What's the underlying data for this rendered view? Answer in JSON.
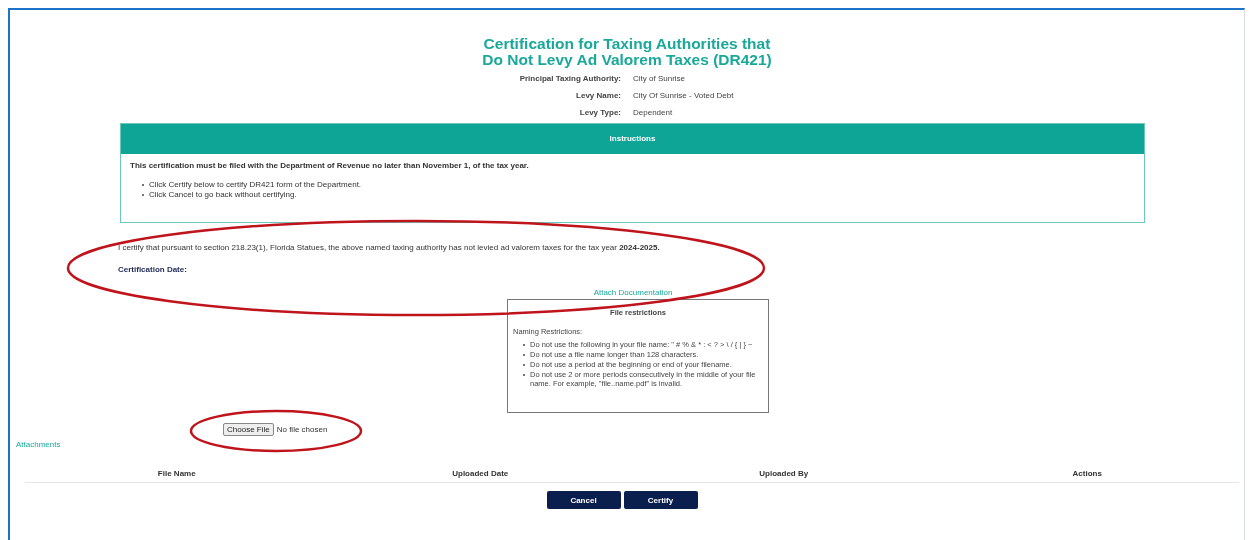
{
  "title_lines": [
    "Certification for Taxing Authorities that",
    "Do Not Levy Ad Valorem Taxes (DR421)"
  ],
  "details": [
    {
      "label": "Principal Taxing Authority:",
      "value": "City of Sunrise"
    },
    {
      "label": "Levy Name:",
      "value": "City Of Sunrise - Voted Debt"
    },
    {
      "label": "Levy Type:",
      "value": "Dependent"
    }
  ],
  "instructions": {
    "heading": "Instructions",
    "notice": "This certification must be filed with the Department of Revenue no later than November 1, of the tax year.",
    "steps": [
      "Click Certify below to certify DR421 form of the Department.",
      "Click Cancel to go back without certifying."
    ]
  },
  "certification_statement": "I certify that pursuant to section 218.23(1), Florida Statues, the above named taxing authority has not levied ad valorem taxes for the tax year **2024-2025.**",
  "certification_date_label": "Certification Date:",
  "attach_heading": "Attach Documentation",
  "file_restrictions": {
    "title": "File restrictions",
    "subtitle": "Naming Restrictions:",
    "rules": [
      "Do not use the following in your file name: \" # % & * : < ? > \\ / { | } ~",
      "Do not use a file name longer than 128 characters.",
      "Do not use a period at the beginning or end of your filename.",
      "Do not use 2 or more periods consecutively in the middle of your file name. For example, \"file..name.pdf\" is invalid."
    ]
  },
  "file_input": {
    "button": "Choose File",
    "status": "No file chosen"
  },
  "attachments_heading": "Attachments",
  "table": {
    "columns": [
      "File Name",
      "Uploaded Date",
      "Uploaded By",
      "Actions"
    ]
  },
  "buttons": [
    "Cancel",
    "Certify"
  ]
}
